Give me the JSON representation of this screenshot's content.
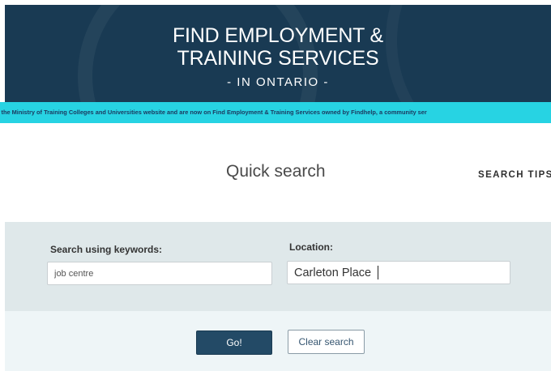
{
  "header": {
    "title": "FIND EMPLOYMENT &\nTRAINING SERVICES",
    "subtitle": "- IN ONTARIO -"
  },
  "ticker": {
    "text": "t the Ministry of Training Colleges and Universities website and are now on Find Employment & Training Services owned by Findhelp, a community ser"
  },
  "search": {
    "title": "Quick search",
    "tips_label": "SEARCH TIPS",
    "keywords_label": "Search using keywords:",
    "keywords_value": "job centre",
    "location_label": "Location:",
    "location_value": "Carleton Place",
    "go_label": "Go!",
    "clear_label": "Clear search"
  },
  "colors": {
    "header_bg": "#193a53",
    "ticker_bg": "#27d3e3",
    "go_button": "#234a66"
  }
}
